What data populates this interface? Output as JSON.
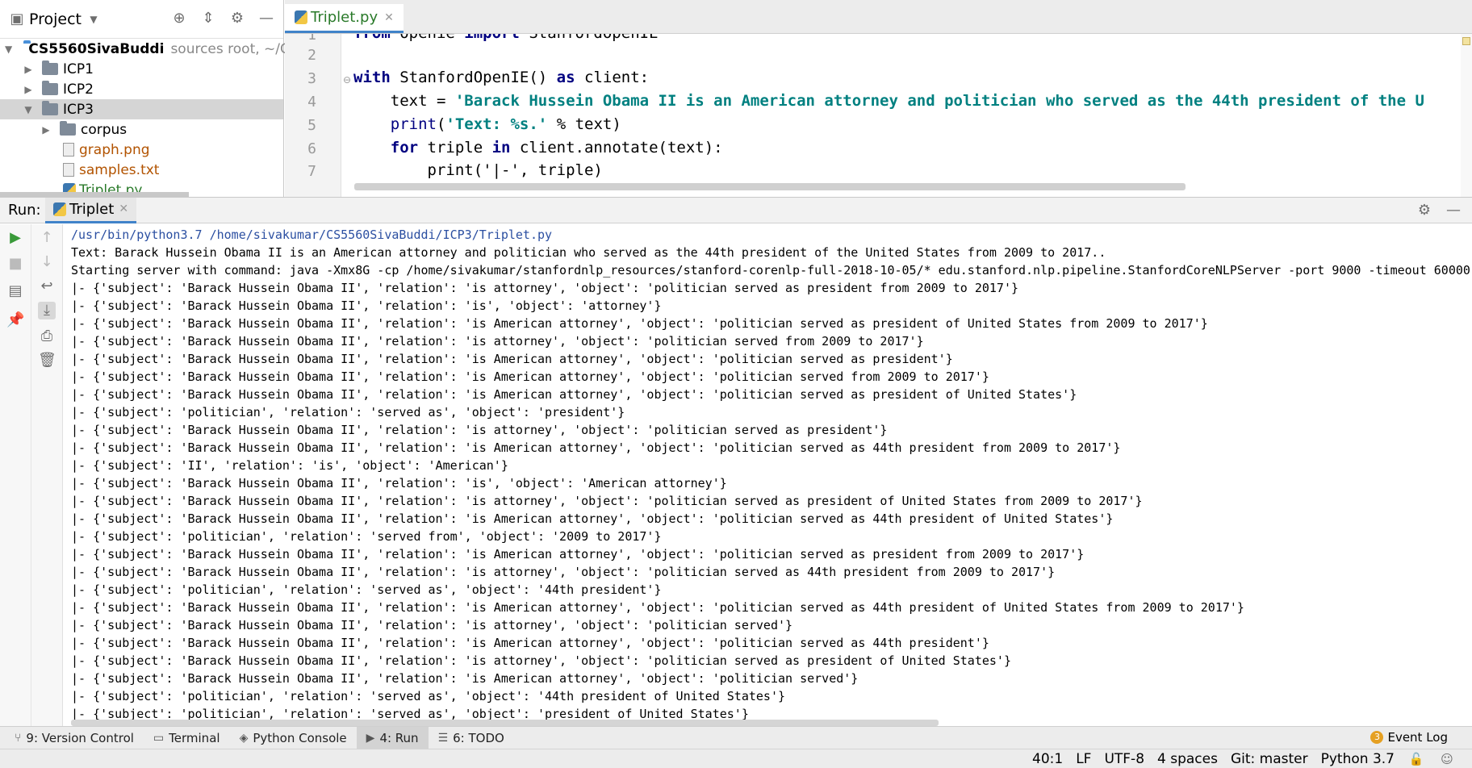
{
  "project": {
    "title": "Project",
    "tree": [
      {
        "label": "CS5560SivaBuddi",
        "suffix": "sources root, ~/C"
      },
      {
        "label": "ICP1"
      },
      {
        "label": "ICP2"
      },
      {
        "label": "ICP3"
      },
      {
        "label": "corpus"
      },
      {
        "label": "graph.png"
      },
      {
        "label": "samples.txt"
      },
      {
        "label": "Triplet.py"
      }
    ]
  },
  "editor": {
    "tab_label": "Triplet.py",
    "line_numbers": [
      "1",
      "2",
      "3",
      "4",
      "5",
      "6",
      "7"
    ],
    "code": {
      "l1_kw1": "from",
      "l1_mod": " openie ",
      "l1_kw2": "import",
      "l1_cls": " StanfordOpenIE",
      "l3_kw": "with",
      "l3_rest": " StanfordOpenIE() ",
      "l3_as": "as",
      "l3_end": " client:",
      "l4_var": "    text = ",
      "l4_str": "'Barack Hussein Obama II is an American attorney and politician who served as the 44th president of the U",
      "l5_fn": "    print",
      "l5_open": "(",
      "l5_str": "'Text: %s.'",
      "l5_end": " % text)",
      "l6_kw": "    for",
      "l6_mid": " triple ",
      "l6_in": "in",
      "l6_end": " client.annotate(text):",
      "l7": "        print('|-', triple)"
    }
  },
  "run": {
    "label": "Run:",
    "tab_label": "Triplet",
    "lines": [
      "/usr/bin/python3.7 /home/sivakumar/CS5560SivaBuddi/ICP3/Triplet.py",
      "Text: Barack Hussein Obama II is an American attorney and politician who served as the 44th president of the United States from 2009 to 2017..",
      "Starting server with command: java -Xmx8G -cp /home/sivakumar/stanfordnlp_resources/stanford-corenlp-full-2018-10-05/* edu.stanford.nlp.pipeline.StanfordCoreNLPServer -port 9000 -timeout 60000",
      "|- {'subject': 'Barack Hussein Obama II', 'relation': 'is attorney', 'object': 'politician served as president from 2009 to 2017'}",
      "|- {'subject': 'Barack Hussein Obama II', 'relation': 'is', 'object': 'attorney'}",
      "|- {'subject': 'Barack Hussein Obama II', 'relation': 'is American attorney', 'object': 'politician served as president of United States from 2009 to 2017'}",
      "|- {'subject': 'Barack Hussein Obama II', 'relation': 'is attorney', 'object': 'politician served from 2009 to 2017'}",
      "|- {'subject': 'Barack Hussein Obama II', 'relation': 'is American attorney', 'object': 'politician served as president'}",
      "|- {'subject': 'Barack Hussein Obama II', 'relation': 'is American attorney', 'object': 'politician served from 2009 to 2017'}",
      "|- {'subject': 'Barack Hussein Obama II', 'relation': 'is American attorney', 'object': 'politician served as president of United States'}",
      "|- {'subject': 'politician', 'relation': 'served as', 'object': 'president'}",
      "|- {'subject': 'Barack Hussein Obama II', 'relation': 'is attorney', 'object': 'politician served as president'}",
      "|- {'subject': 'Barack Hussein Obama II', 'relation': 'is American attorney', 'object': 'politician served as 44th president from 2009 to 2017'}",
      "|- {'subject': 'II', 'relation': 'is', 'object': 'American'}",
      "|- {'subject': 'Barack Hussein Obama II', 'relation': 'is', 'object': 'American attorney'}",
      "|- {'subject': 'Barack Hussein Obama II', 'relation': 'is attorney', 'object': 'politician served as president of United States from 2009 to 2017'}",
      "|- {'subject': 'Barack Hussein Obama II', 'relation': 'is American attorney', 'object': 'politician served as 44th president of United States'}",
      "|- {'subject': 'politician', 'relation': 'served from', 'object': '2009 to 2017'}",
      "|- {'subject': 'Barack Hussein Obama II', 'relation': 'is American attorney', 'object': 'politician served as president from 2009 to 2017'}",
      "|- {'subject': 'Barack Hussein Obama II', 'relation': 'is attorney', 'object': 'politician served as 44th president from 2009 to 2017'}",
      "|- {'subject': 'politician', 'relation': 'served as', 'object': '44th president'}",
      "|- {'subject': 'Barack Hussein Obama II', 'relation': 'is American attorney', 'object': 'politician served as 44th president of United States from 2009 to 2017'}",
      "|- {'subject': 'Barack Hussein Obama II', 'relation': 'is attorney', 'object': 'politician served'}",
      "|- {'subject': 'Barack Hussein Obama II', 'relation': 'is American attorney', 'object': 'politician served as 44th president'}",
      "|- {'subject': 'Barack Hussein Obama II', 'relation': 'is attorney', 'object': 'politician served as president of United States'}",
      "|- {'subject': 'Barack Hussein Obama II', 'relation': 'is American attorney', 'object': 'politician served'}",
      "|- {'subject': 'politician', 'relation': 'served as', 'object': '44th president of United States'}",
      "|- {'subject': 'politician', 'relation': 'served as', 'object': 'president of United States'}"
    ]
  },
  "tool_tabs": {
    "version_control": "9: Version Control",
    "terminal": "Terminal",
    "python_console": "Python Console",
    "run": "4: Run",
    "todo": "6: TODO",
    "event_log": "Event Log",
    "event_count": "3"
  },
  "status": {
    "position": "40:1",
    "line_sep": "LF",
    "encoding": "UTF-8",
    "indent": "4 spaces",
    "git": "Git: master",
    "interpreter": "Python 3.7"
  }
}
